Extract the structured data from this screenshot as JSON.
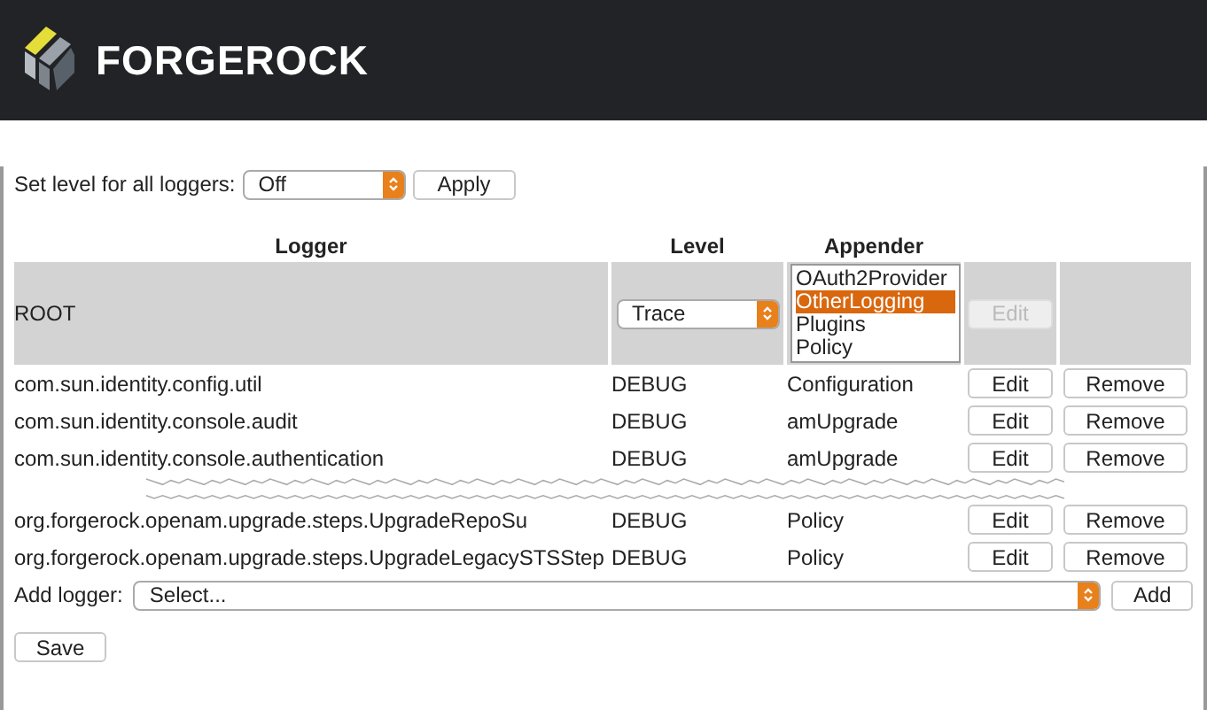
{
  "header": {
    "brand": "FORGEROCK"
  },
  "set_level": {
    "label": "Set level for all loggers:",
    "value": "Off",
    "button": "Apply"
  },
  "table": {
    "columns": [
      "Logger",
      "Level",
      "Appender"
    ],
    "root": {
      "logger": "ROOT",
      "level": "Trace",
      "appenders": [
        {
          "label": "OAuth2Provider",
          "selected": false
        },
        {
          "label": "OtherLogging",
          "selected": true
        },
        {
          "label": "Plugins",
          "selected": false
        },
        {
          "label": "Policy",
          "selected": false
        }
      ],
      "edit": {
        "label": "Edit",
        "disabled": true
      }
    },
    "rows": [
      {
        "kind": "row",
        "logger": "com.sun.identity.config.util",
        "level": "DEBUG",
        "appender": "Configuration",
        "edit": "Edit",
        "remove": "Remove"
      },
      {
        "kind": "row",
        "logger": "com.sun.identity.console.audit",
        "level": "DEBUG",
        "appender": "amUpgrade",
        "edit": "Edit",
        "remove": "Remove"
      },
      {
        "kind": "row",
        "logger": "com.sun.identity.console.authentication",
        "level": "DEBUG",
        "appender": "amUpgrade",
        "edit": "Edit",
        "remove": "Remove"
      },
      {
        "kind": "tear"
      },
      {
        "kind": "row",
        "logger": "org.forgerock.openam.upgrade.steps.UpgradeRepoSu",
        "level": "DEBUG",
        "appender": "Policy",
        "edit": "Edit",
        "remove": "Remove"
      },
      {
        "kind": "row",
        "logger": "org.forgerock.openam.upgrade.steps.UpgradeLegacySTSStep",
        "level": "DEBUG",
        "appender": "Policy",
        "edit": "Edit",
        "remove": "Remove"
      }
    ]
  },
  "add_logger": {
    "label": "Add logger:",
    "value": "Select...",
    "button": "Add"
  },
  "save": "Save"
}
